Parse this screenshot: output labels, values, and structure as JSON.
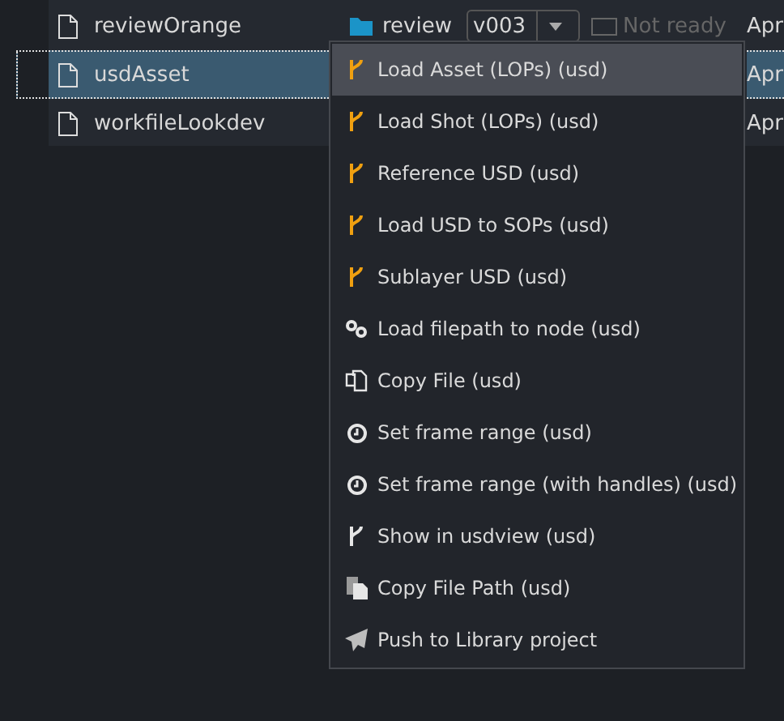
{
  "rows": [
    {
      "name": "reviewOrange",
      "selected": false,
      "task": "review",
      "version": "v003",
      "status": "Not ready",
      "date": "Apr"
    },
    {
      "name": "usdAsset",
      "selected": true,
      "date": "Apr"
    },
    {
      "name": "workfileLookdev",
      "selected": false,
      "date": "Apr"
    }
  ],
  "context_menu": {
    "items": [
      {
        "label": "Load Asset (LOPs) (usd)",
        "kind": "loader",
        "selected": true
      },
      {
        "label": "Load Shot (LOPs) (usd)",
        "kind": "loader",
        "selected": false
      },
      {
        "label": "Reference USD (usd)",
        "kind": "loader",
        "selected": false
      },
      {
        "label": "Load USD to SOPs (usd)",
        "kind": "loader",
        "selected": false
      },
      {
        "label": "Sublayer USD (usd)",
        "kind": "loader",
        "selected": false
      },
      {
        "label": "Load filepath to node (usd)",
        "kind": "link",
        "selected": false
      },
      {
        "label": "Copy File (usd)",
        "kind": "copy",
        "selected": false
      },
      {
        "label": "Set frame range (usd)",
        "kind": "clock",
        "selected": false
      },
      {
        "label": "Set frame range (with handles) (usd)",
        "kind": "clock",
        "selected": false
      },
      {
        "label": "Show in usdview (usd)",
        "kind": "viewer",
        "selected": false
      },
      {
        "label": "Copy File Path (usd)",
        "kind": "paste",
        "selected": false
      },
      {
        "label": "Push to Library project",
        "kind": "send",
        "selected": false
      }
    ]
  }
}
